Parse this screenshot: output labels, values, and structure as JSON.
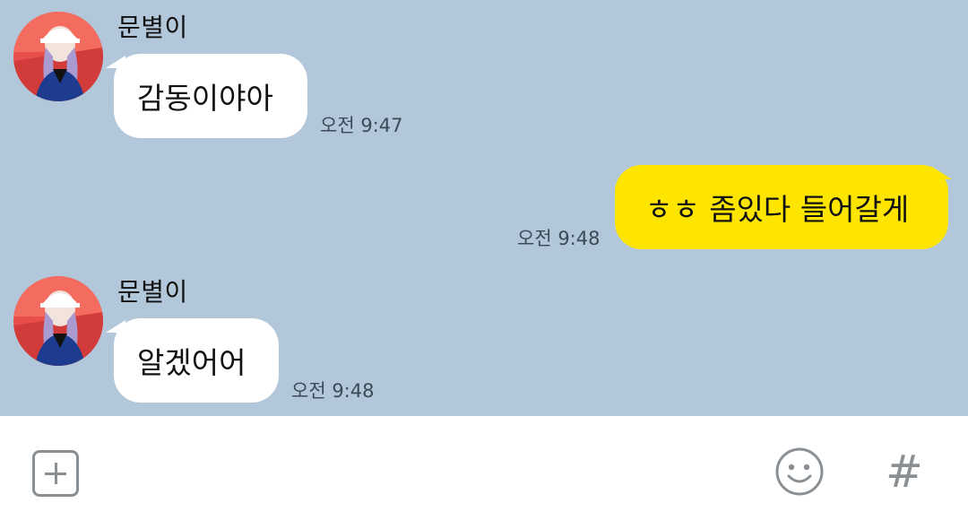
{
  "messages": [
    {
      "sender": "문별이",
      "text": "감동이야아",
      "time": "오전 9:47"
    },
    {
      "text": "ㅎㅎ 좀있다 들어갈게",
      "time": "오전 9:48"
    },
    {
      "sender": "문별이",
      "text": "알겠어어",
      "time": "오전 9:48"
    }
  ],
  "input_bar": {
    "plus_icon": "plus-square-icon",
    "emoji_icon": "smile-icon",
    "hash_label": "#"
  },
  "colors": {
    "chat_background": "#b2c7da",
    "incoming_bubble": "#ffffff",
    "outgoing_bubble": "#fee500"
  }
}
